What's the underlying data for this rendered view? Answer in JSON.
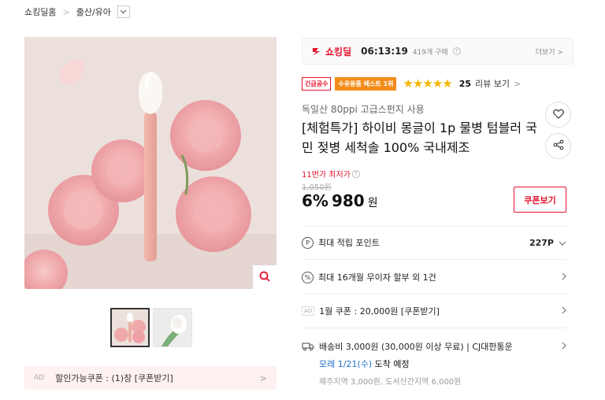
{
  "breadcrumb": {
    "home": "쇼킹딜홈",
    "sep": ">",
    "category": "출산/유아",
    "dropdown_icon": "chevron-down-icon"
  },
  "deal": {
    "logo": "쇼킹딜",
    "timer": "06:13:19",
    "bought": "419개 구매",
    "info": "?",
    "more": "더보기 >"
  },
  "badges": {
    "urgent": "긴급공수",
    "best": "수유용품 베스트 1위"
  },
  "review": {
    "stars": "★★★★★",
    "count": "25",
    "link": "리뷰 보기",
    "chevron": ">"
  },
  "product": {
    "subtitle": "독일산 80ppi 고급스펀지 사용",
    "title": "[체험특가] 하이비 몽글이 1p 물병 텀블러 국민 젖병 세척솔 100% 국내제조"
  },
  "price": {
    "lowest_label": "11번가 최저가",
    "original": "1,050원",
    "discount": "6%",
    "sale": "980",
    "won": "원",
    "coupon_btn": "쿠폰보기"
  },
  "rows": {
    "points_label": "최대 적립 포인트",
    "points_value": "227P",
    "installment": "최대 16개월 무이자 할부 외 1건",
    "ad_tag": "AD",
    "coupon_text": "1월 쿠폰 : 20,000원 [쿠폰받기]"
  },
  "shipping": {
    "line1": "배송비 3,000원 (30,000원 이상 무료) | CJ대한통운",
    "arrival_date": "모레 1/21(수)",
    "arrival_suffix": "도착 예정",
    "extra": "제주지역 3,000원, 도서산간지역 6,000원"
  },
  "ad_coupon": {
    "tag": "AD",
    "text": "할인가능쿠폰 : (1)장 [쿠폰받기]",
    "chevron": ">"
  },
  "icons": [
    "search-icon",
    "heart-icon",
    "share-icon",
    "point-icon",
    "installment-icon",
    "truck-icon",
    "chevron-right-icon"
  ],
  "colors": {
    "accent": "#e8112d",
    "star": "#f7b500",
    "best_badge": "#f28c1b",
    "arrival": "#1d6fd1"
  }
}
